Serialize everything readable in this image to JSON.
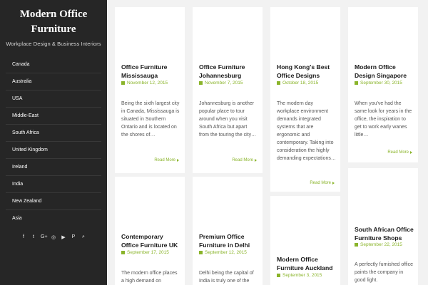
{
  "site": {
    "title_line1": "Modern Office",
    "title_line2": "Furniture",
    "tagline": "Workplace Design & Business Interiors"
  },
  "nav": [
    "Canada",
    "Australia",
    "USA",
    "Middle-East",
    "South Africa",
    "United Kingdom",
    "Ireland",
    "India",
    "New Zealand",
    "Asia"
  ],
  "social": {
    "facebook": "f",
    "twitter": "t",
    "googleplus": "G+",
    "instagram": "◎",
    "youtube": "▶",
    "pinterest": "P",
    "search": "⌕"
  },
  "posts": [
    {
      "title": "Office Furniture Mississauga",
      "date": "November 12, 2015",
      "excerpt": "Being the sixth largest city in Canada, Mississauga is situated in Southern Ontario and is located on the shores of…",
      "more": "Read More"
    },
    {
      "title": "Office Furniture Johannesburg",
      "date": "November 7, 2015",
      "excerpt": "Johannesburg is another popular place to tour around when you visit South Africa but apart from the touring the city…",
      "more": "Read More"
    },
    {
      "title": "Hong Kong's Best Office Designs",
      "date": "October 18, 2015",
      "excerpt": "The modern day workplace environment demands integrated systems that are ergonomic and contemporary. Taking into consideration the highly demanding expectations…",
      "more": "Read More"
    },
    {
      "title": "Modern Office Design Singapore",
      "date": "September 30, 2015",
      "excerpt": "When you've had the same look for years in the office, the inspiration to get to work early wanes little…",
      "more": "Read More"
    },
    {
      "title": "Contemporary Office Furniture UK",
      "date": "September 17, 2015",
      "excerpt": "The modern office places a high demand on"
    },
    {
      "title": "Premium Office Furniture in Delhi",
      "date": "September 12, 2015",
      "excerpt": "Delhi being the capital of India is truly one of the"
    },
    {
      "title": "Modern Office Furniture Auckland",
      "date": "September 3, 2015",
      "excerpt": ""
    },
    {
      "title": "South African Office Furniture Shops",
      "date": "September 22, 2015",
      "excerpt": "A perfectly furnished office paints the company in good light."
    }
  ]
}
